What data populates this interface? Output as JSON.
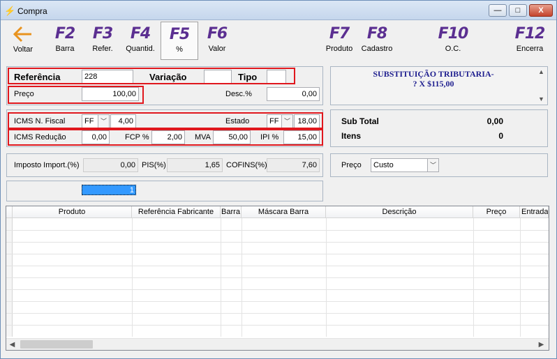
{
  "window": {
    "title": "Compra",
    "buttons": {
      "minimize": "—",
      "maximize": "□",
      "close": "X"
    }
  },
  "toolbar": {
    "voltar_label": "Voltar",
    "f2": {
      "key": "F2",
      "label": "Barra"
    },
    "f3": {
      "key": "F3",
      "label": "Refer."
    },
    "f4": {
      "key": "F4",
      "label": "Quantid."
    },
    "f5": {
      "key": "F5",
      "label": "%"
    },
    "f6": {
      "key": "F6",
      "label": "Valor"
    },
    "f7": {
      "key": "F7",
      "label": "Produto"
    },
    "f8": {
      "key": "F8",
      "label": "Cadastro"
    },
    "f10": {
      "key": "F10",
      "label": "O.C."
    },
    "f12": {
      "key": "F12",
      "label": "Encerra"
    }
  },
  "product": {
    "referencia_label": "Referência",
    "referencia_value": "228",
    "variacao_label": "Variação",
    "variacao_value": "",
    "tipo_label": "Tipo",
    "tipo_value": "",
    "preco_label": "Preço",
    "preco_value": "100,00",
    "desc_label": "Desc.%",
    "desc_value": "0,00"
  },
  "info": {
    "line1": "SUBSTITUIÇÃO TRIBUTARIA-",
    "line2": "? X $115,00"
  },
  "taxes": {
    "icms_nf_label": "ICMS N. Fiscal",
    "icms_nf_type": "FF",
    "icms_nf_value": "4,00",
    "estado_label": "Estado",
    "estado_type": "FF",
    "estado_value": "18,00",
    "icms_red_label": "ICMS Redução",
    "icms_red_value": "0,00",
    "fcp_label": "FCP %",
    "fcp_value": "2,00",
    "mva_label": "MVA",
    "mva_value": "50,00",
    "ipi_label": "IPI %",
    "ipi_value": "15,00"
  },
  "totals": {
    "subtotal_label": "Sub Total",
    "subtotal_value": "0,00",
    "itens_label": "Itens",
    "itens_value": "0"
  },
  "imports": {
    "imposto_label": "Imposto Import.(%)",
    "imposto_value": "0,00",
    "pis_label": "PIS(%)",
    "pis_value": "1,65",
    "cofins_label": "COFINS(%)",
    "cofins_value": "7,60"
  },
  "preco_select": {
    "label": "Preço",
    "value": "Custo"
  },
  "quantity": {
    "value": "1"
  },
  "grid": {
    "columns": [
      "Produto",
      "Referência Fabricante",
      "Barra",
      "Máscara Barra",
      "Descrição",
      "Preço",
      "Entrada"
    ]
  },
  "colors": {
    "fkey": "#5b2f91",
    "highlight": "#e0171d",
    "info_text": "#1f1f8f"
  }
}
